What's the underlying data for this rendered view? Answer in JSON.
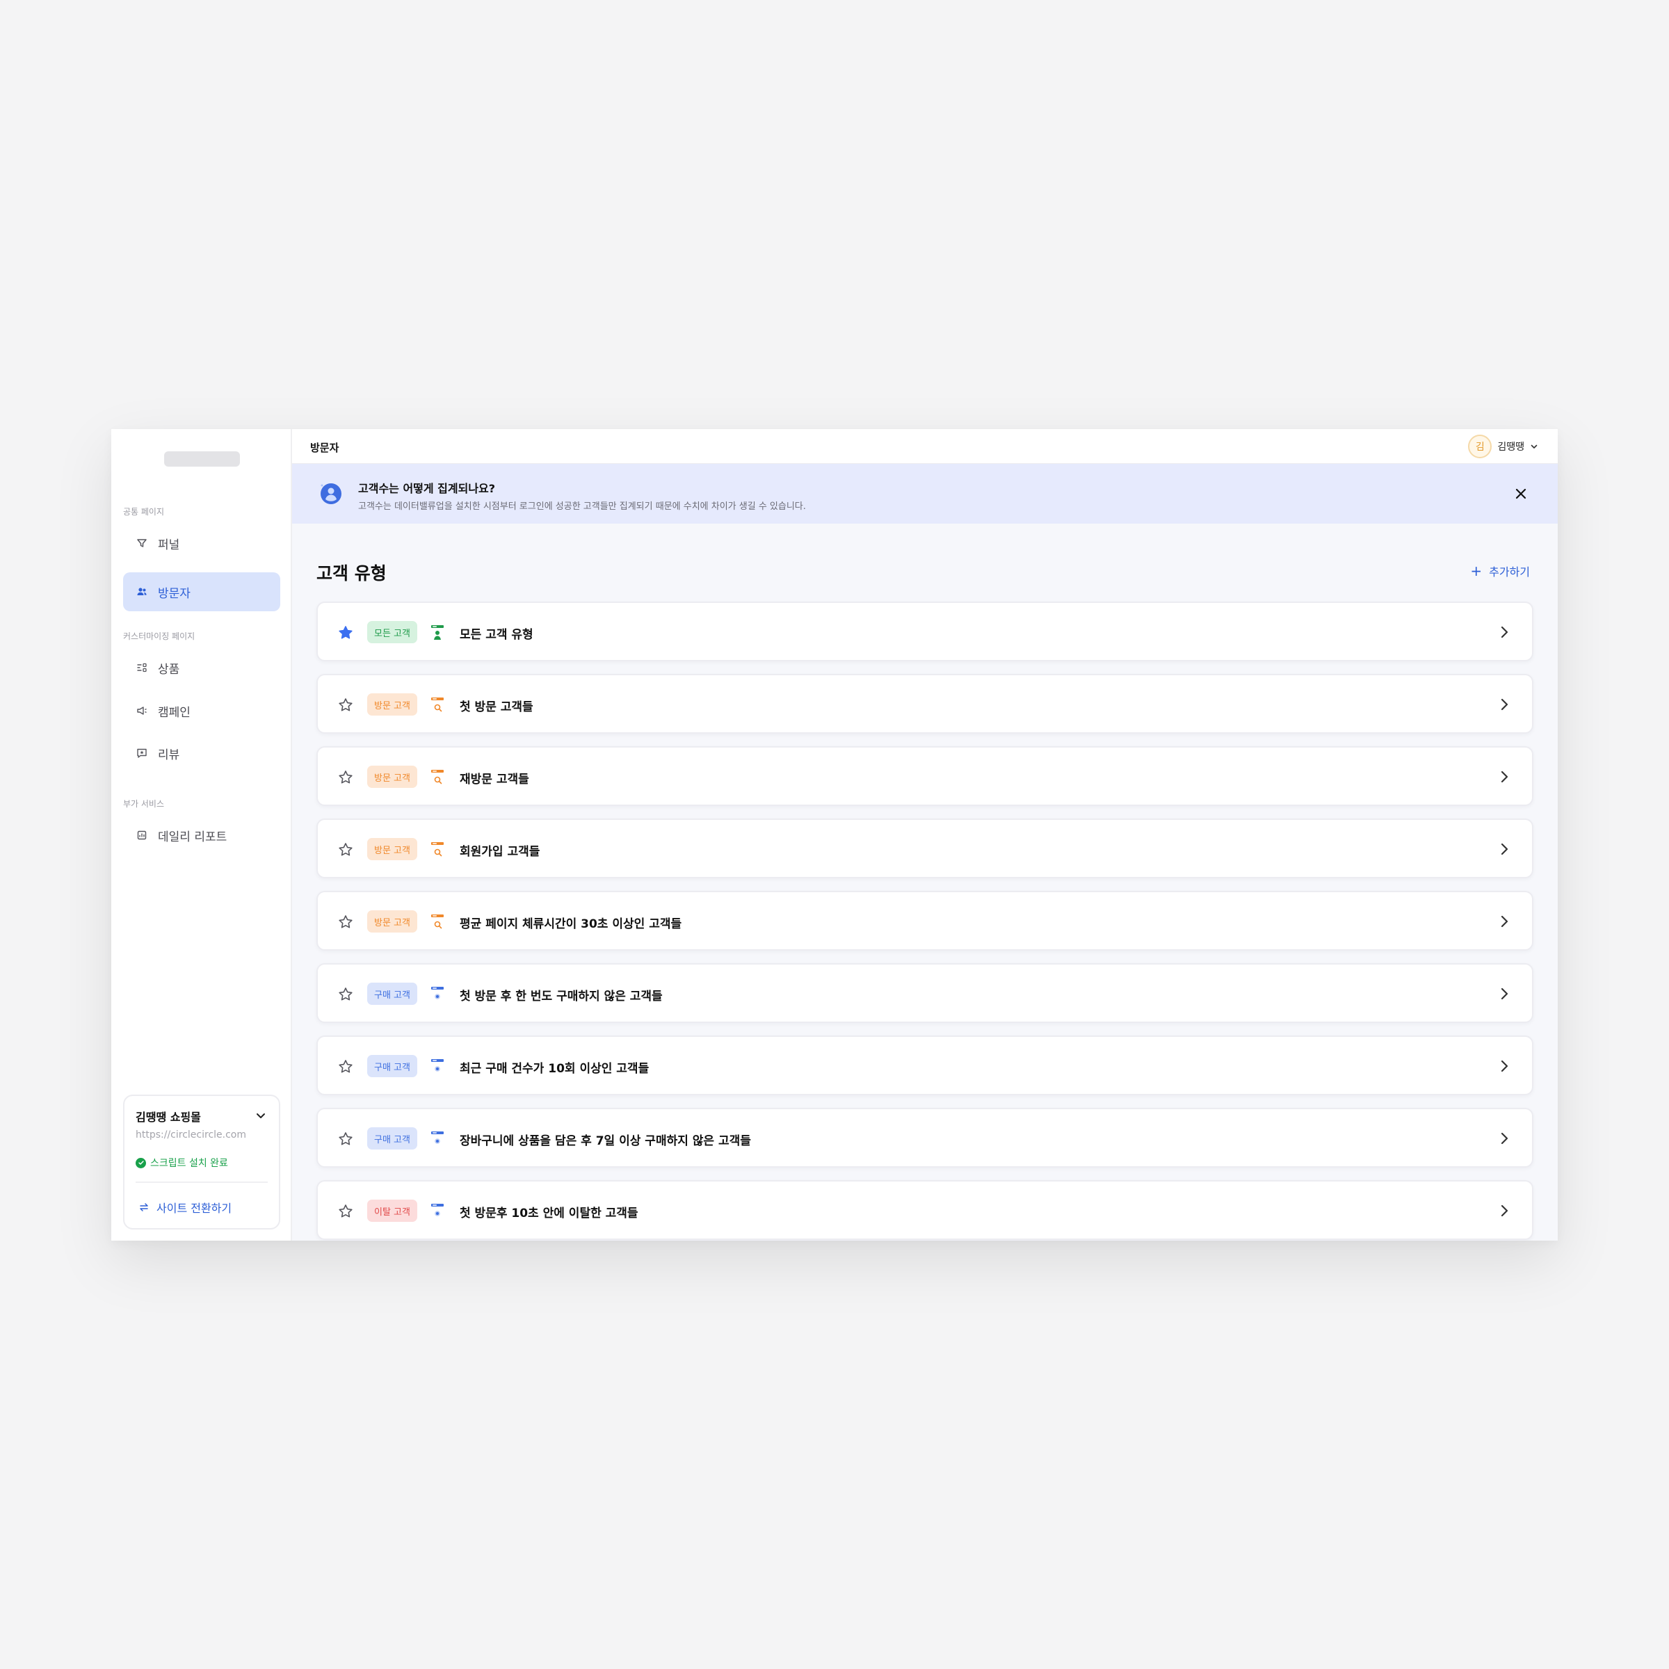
{
  "sidebar": {
    "sections": {
      "common": "공통 페이지",
      "custom": "커스터마이징 페이지",
      "extra": "부가 서비스"
    },
    "items": [
      {
        "label": "퍼널",
        "icon": "funnel-icon"
      },
      {
        "label": "방문자",
        "icon": "users-icon",
        "active": true
      },
      {
        "label": "상품",
        "icon": "product-icon"
      },
      {
        "label": "캠페인",
        "icon": "megaphone-icon"
      },
      {
        "label": "리뷰",
        "icon": "review-icon"
      },
      {
        "label": "데일리 리포트",
        "icon": "report-icon"
      }
    ],
    "site": {
      "name": "김땡땡 쇼핑몰",
      "url": "https://circlecircle.com",
      "status": "스크립트 설치 완료",
      "switch_label": "사이트 전환하기"
    }
  },
  "topbar": {
    "title": "방문자",
    "user": {
      "avatar_initial": "김",
      "name": "김땡땡"
    }
  },
  "banner": {
    "title": "고객수는 어떻게 집계되나요?",
    "description": "고객수는 데이터밸류업을 설치한 시점부터 로그인에 성공한 고객들만 집계되기 때문에 수치에 차이가 생길 수 있습니다."
  },
  "main": {
    "section_title": "고객 유형",
    "add_label": "추가하기",
    "rows": [
      {
        "badge": "모든 고객",
        "kind": "all",
        "title": "모든 고객 유형",
        "starred": true
      },
      {
        "badge": "방문 고객",
        "kind": "visit",
        "title": "첫 방문 고객들",
        "starred": false
      },
      {
        "badge": "방문 고객",
        "kind": "visit",
        "title": "재방문 고객들",
        "starred": false
      },
      {
        "badge": "방문 고객",
        "kind": "visit",
        "title": "회원가입 고객들",
        "starred": false
      },
      {
        "badge": "방문 고객",
        "kind": "visit",
        "title": "평균 페이지 체류시간이 30초 이상인 고객들",
        "starred": false
      },
      {
        "badge": "구매 고객",
        "kind": "buy",
        "title": "첫 방문 후 한 번도 구매하지 않은 고객들",
        "starred": false
      },
      {
        "badge": "구매 고객",
        "kind": "buy",
        "title": "최근 구매 건수가 10회 이상인 고객들",
        "starred": false
      },
      {
        "badge": "구매 고객",
        "kind": "buy",
        "title": "장바구니에 상품을 담은 후 7일 이상 구매하지 않은 고객들",
        "starred": false
      },
      {
        "badge": "이탈 고객",
        "kind": "churn",
        "title": "첫 방문후 10초 안에 이탈한 고객들",
        "starred": false
      }
    ]
  },
  "colors": {
    "accent": "#2d5fd6",
    "star_active": "#3b6ff0",
    "success": "#18a04a",
    "banner_bg": "#e6eafd"
  }
}
